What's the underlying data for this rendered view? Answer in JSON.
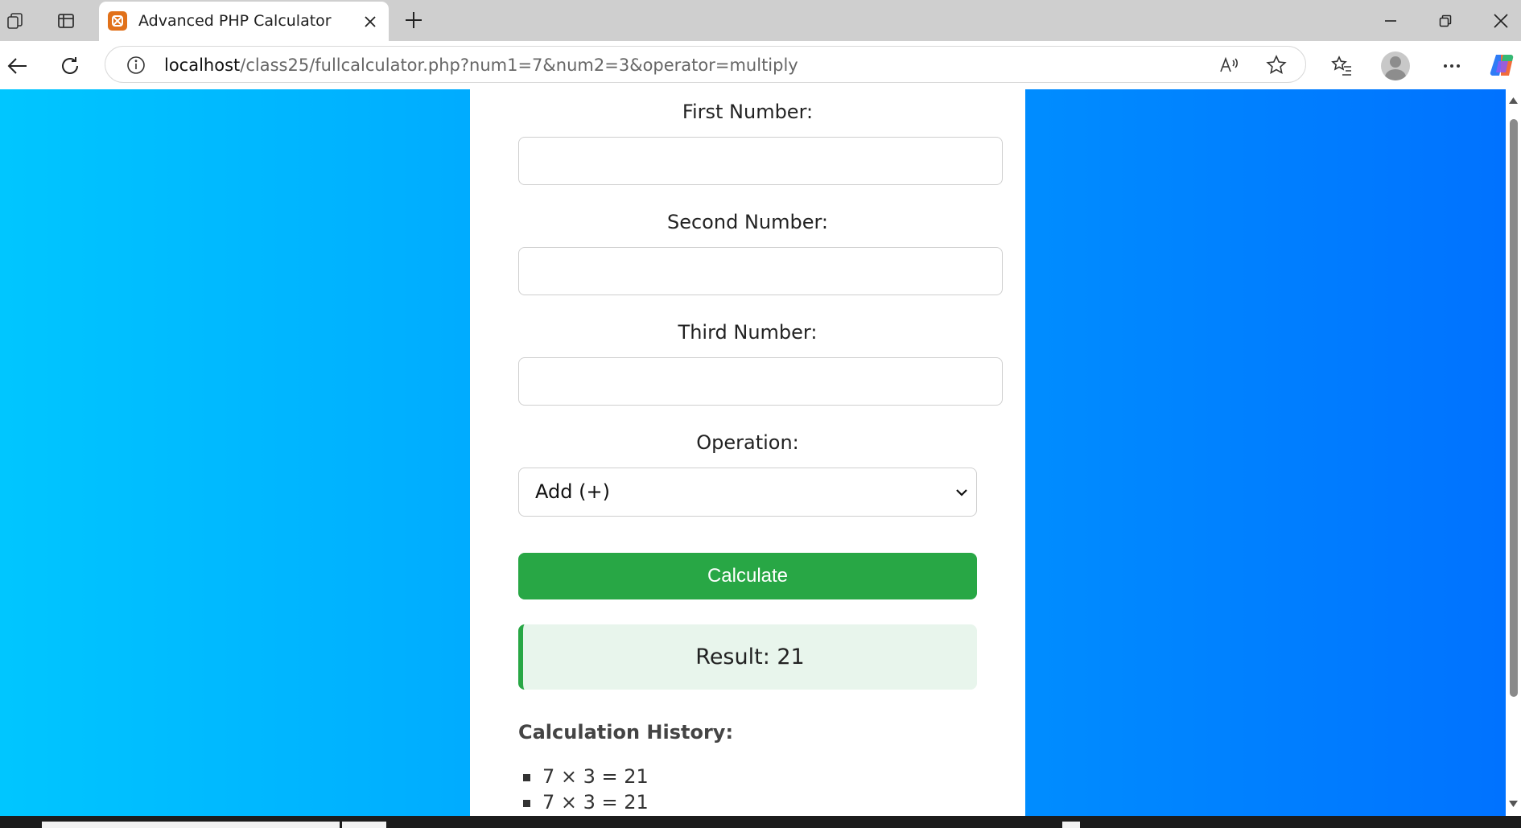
{
  "browser": {
    "tab_title": "Advanced PHP Calculator",
    "url_host": "localhost",
    "url_path": "/class25/fullcalculator.php?num1=7&num2=3&operator=multiply",
    "icons": [
      "workspaces-icon",
      "tab-actions-icon",
      "xampp-favicon-icon",
      "close-icon",
      "new-tab-icon",
      "minimize-icon",
      "restore-icon",
      "window-close-icon",
      "back-icon",
      "refresh-icon",
      "info-icon",
      "read-aloud-icon",
      "favorite-star-icon",
      "favorites-icon",
      "profile-avatar",
      "more-icon",
      "copilot-icon"
    ]
  },
  "page": {
    "background_gradient": [
      "#00c6ff",
      "#0072ff"
    ],
    "accent_color": "#28a745",
    "form": {
      "first_label": "First Number:",
      "first_value": "",
      "second_label": "Second Number:",
      "second_value": "",
      "third_label": "Third Number:",
      "third_value": "",
      "operation_label": "Operation:",
      "operation_selected": "Add (+)",
      "calculate_label": "Calculate"
    },
    "result_text": "Result: 21",
    "history": {
      "title": "Calculation History:",
      "items": [
        "7 × 3 = 21",
        "7 × 3 = 21"
      ]
    }
  }
}
